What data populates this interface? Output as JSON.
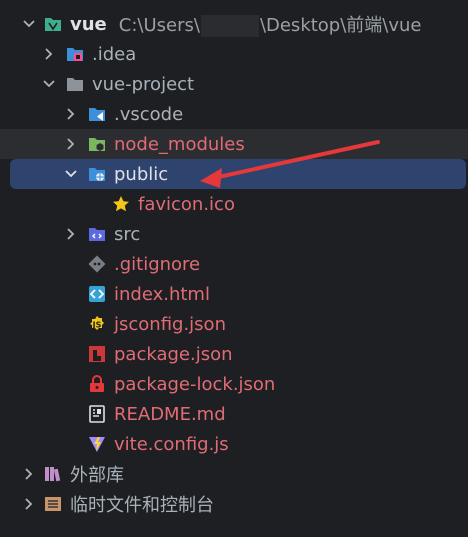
{
  "colors": {
    "background": "#1e1f22",
    "selection": "#2e436e",
    "ignored_row": "#2b2d30",
    "modified_red": "#e06c75",
    "arrow_red": "#e5383b"
  },
  "root": {
    "name": "vue",
    "path_prefix": "C:\\Users\\",
    "path_suffix": "\\Desktop\\前端\\vue",
    "icon": "module-folder-icon"
  },
  "tree": {
    "idea": {
      "label": ".idea",
      "icon": "idea-folder-icon"
    },
    "vue_project": {
      "label": "vue-project",
      "icon": "folder-icon"
    },
    "vscode": {
      "label": ".vscode",
      "icon": "vscode-folder-icon"
    },
    "node_modules": {
      "label": "node_modules",
      "icon": "node-modules-folder-icon"
    },
    "public": {
      "label": "public",
      "icon": "web-folder-icon"
    },
    "favicon": {
      "label": "favicon.ico",
      "icon": "star-icon"
    },
    "src": {
      "label": "src",
      "icon": "source-folder-icon"
    },
    "gitignore": {
      "label": ".gitignore",
      "icon": "git-icon"
    },
    "index_html": {
      "label": "index.html",
      "icon": "html-icon"
    },
    "jsconfig": {
      "label": "jsconfig.json",
      "icon": "js-icon"
    },
    "package_json": {
      "label": "package.json",
      "icon": "npm-icon"
    },
    "package_lock": {
      "label": "package-lock.json",
      "icon": "lock-icon"
    },
    "readme": {
      "label": "README.md",
      "icon": "markdown-icon"
    },
    "vite_config": {
      "label": "vite.config.js",
      "icon": "vite-icon"
    },
    "external_libs": {
      "label": "外部库",
      "icon": "library-icon"
    },
    "scratches": {
      "label": "临时文件和控制台",
      "icon": "scratches-icon"
    }
  }
}
